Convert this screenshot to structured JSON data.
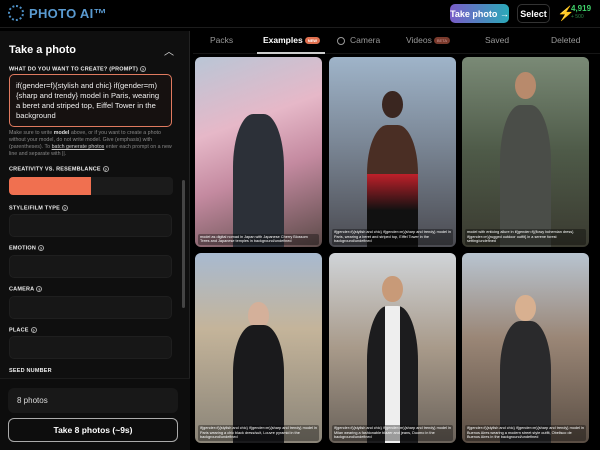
{
  "header": {
    "brand": "PHOTO AI™",
    "take_photo": "Take photo →",
    "select": "Select",
    "credits": "4,919",
    "credits_sub": "+ 500"
  },
  "panel": {
    "title": "Take a photo",
    "prompt_label": "WHAT DO YOU WANT TO CREATE? (PROMPT)",
    "prompt_value": "if(gender=f){stylish and chic} if(gender=m){sharp and trendy} model in Paris, wearing a beret and striped top, Eiffel Tower in the background",
    "help_1": "Make sure to write ",
    "help_model": "model",
    "help_2": " above, or if you want to create a photo without your model, do not write model. Give (emphasis) with (parentheses). To ",
    "help_link": "batch generate photos",
    "help_3": " enter each prompt on a new line and separate with ||.",
    "creativity_label": "CREATIVITY VS. RESEMBLANCE",
    "creativity_value": 0.5,
    "style_label": "STYLE/FILM TYPE",
    "emotion_label": "EMOTION",
    "camera_label": "CAMERA",
    "place_label": "PLACE",
    "seed_label": "SEED NUMBER",
    "count_value": "8 photos",
    "submit": "Take 8 photos (~9s)"
  },
  "tabs": {
    "packs": "Packs",
    "examples": "Examples",
    "new_badge": "NEW",
    "camera": "Camera",
    "videos": "Videos",
    "videos_badge": "BETA",
    "saved": "Saved",
    "deleted": "Deleted"
  },
  "cards": [
    {
      "caption": "model as digital nomad in Japan with Japanese Cherry Blossom Trees and Japanese temples in background/undefined"
    },
    {
      "caption": "if(gender=f){stylish and chic} if(gender=m){sharp and trendy} model in Paris, wearing a beret and striped top, Eiffel Tower in the background/undefined"
    },
    {
      "caption": "model with enticing allure in if(gender=f){flowy bohemian dress} if(gender=m){rugged outdoor outfit} in a serene forest setting/undefined"
    },
    {
      "caption": "if(gender=f){stylish and chic} if(gender=m){sharp and trendy} model in Paris wearing a chic black dress/suit, Louvre pyramid in the background/undefined"
    },
    {
      "caption": "if(gender=f){stylish and chic} if(gender=m){sharp and trendy} model in Milan wearing a fashionable blazer and jeans, Duomo in the background/undefined"
    },
    {
      "caption": "if(gender=f){stylish and chic} if(gender=m){sharp and trendy} model in Buenos Aires wearing a modern street style outfit, Obelisco de Buenos Aires in the background/undefined"
    }
  ]
}
